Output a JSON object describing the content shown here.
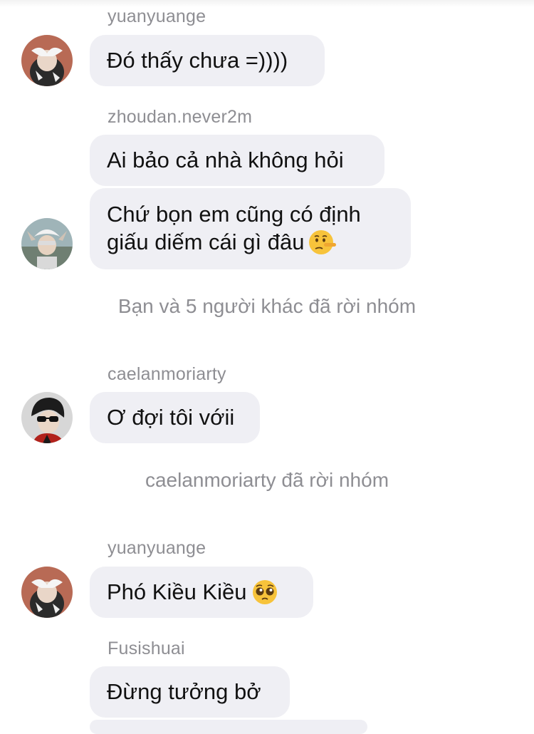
{
  "messages": {
    "m1": {
      "sender": "yuanyuange",
      "text": "Đó thấy chưa =))))"
    },
    "m2": {
      "sender": "zhoudan.never2m",
      "text1": "Ai bảo cả nhà không hỏi",
      "text2_line1": "Chứ bọn em cũng có định",
      "text2_line2": "giấu diếm cái gì đâu",
      "emoji": "lying-face-emoji"
    },
    "system1": "Bạn và 5 người khác đã rời nhóm",
    "m3": {
      "sender": "caelanmoriarty",
      "text": "Ơ đợi tôi vớii"
    },
    "system2": "caelanmoriarty đã rời nhóm",
    "m4": {
      "sender": "yuanyuange",
      "text": "Phó Kiều Kiều",
      "emoji": "pleading-face-emoji"
    },
    "m5": {
      "sender": "Fusishuai",
      "text": "Đừng tưởng bở"
    }
  },
  "colors": {
    "bubble": "#efeff4",
    "meta_text": "#8e8e93",
    "text": "#111111"
  }
}
